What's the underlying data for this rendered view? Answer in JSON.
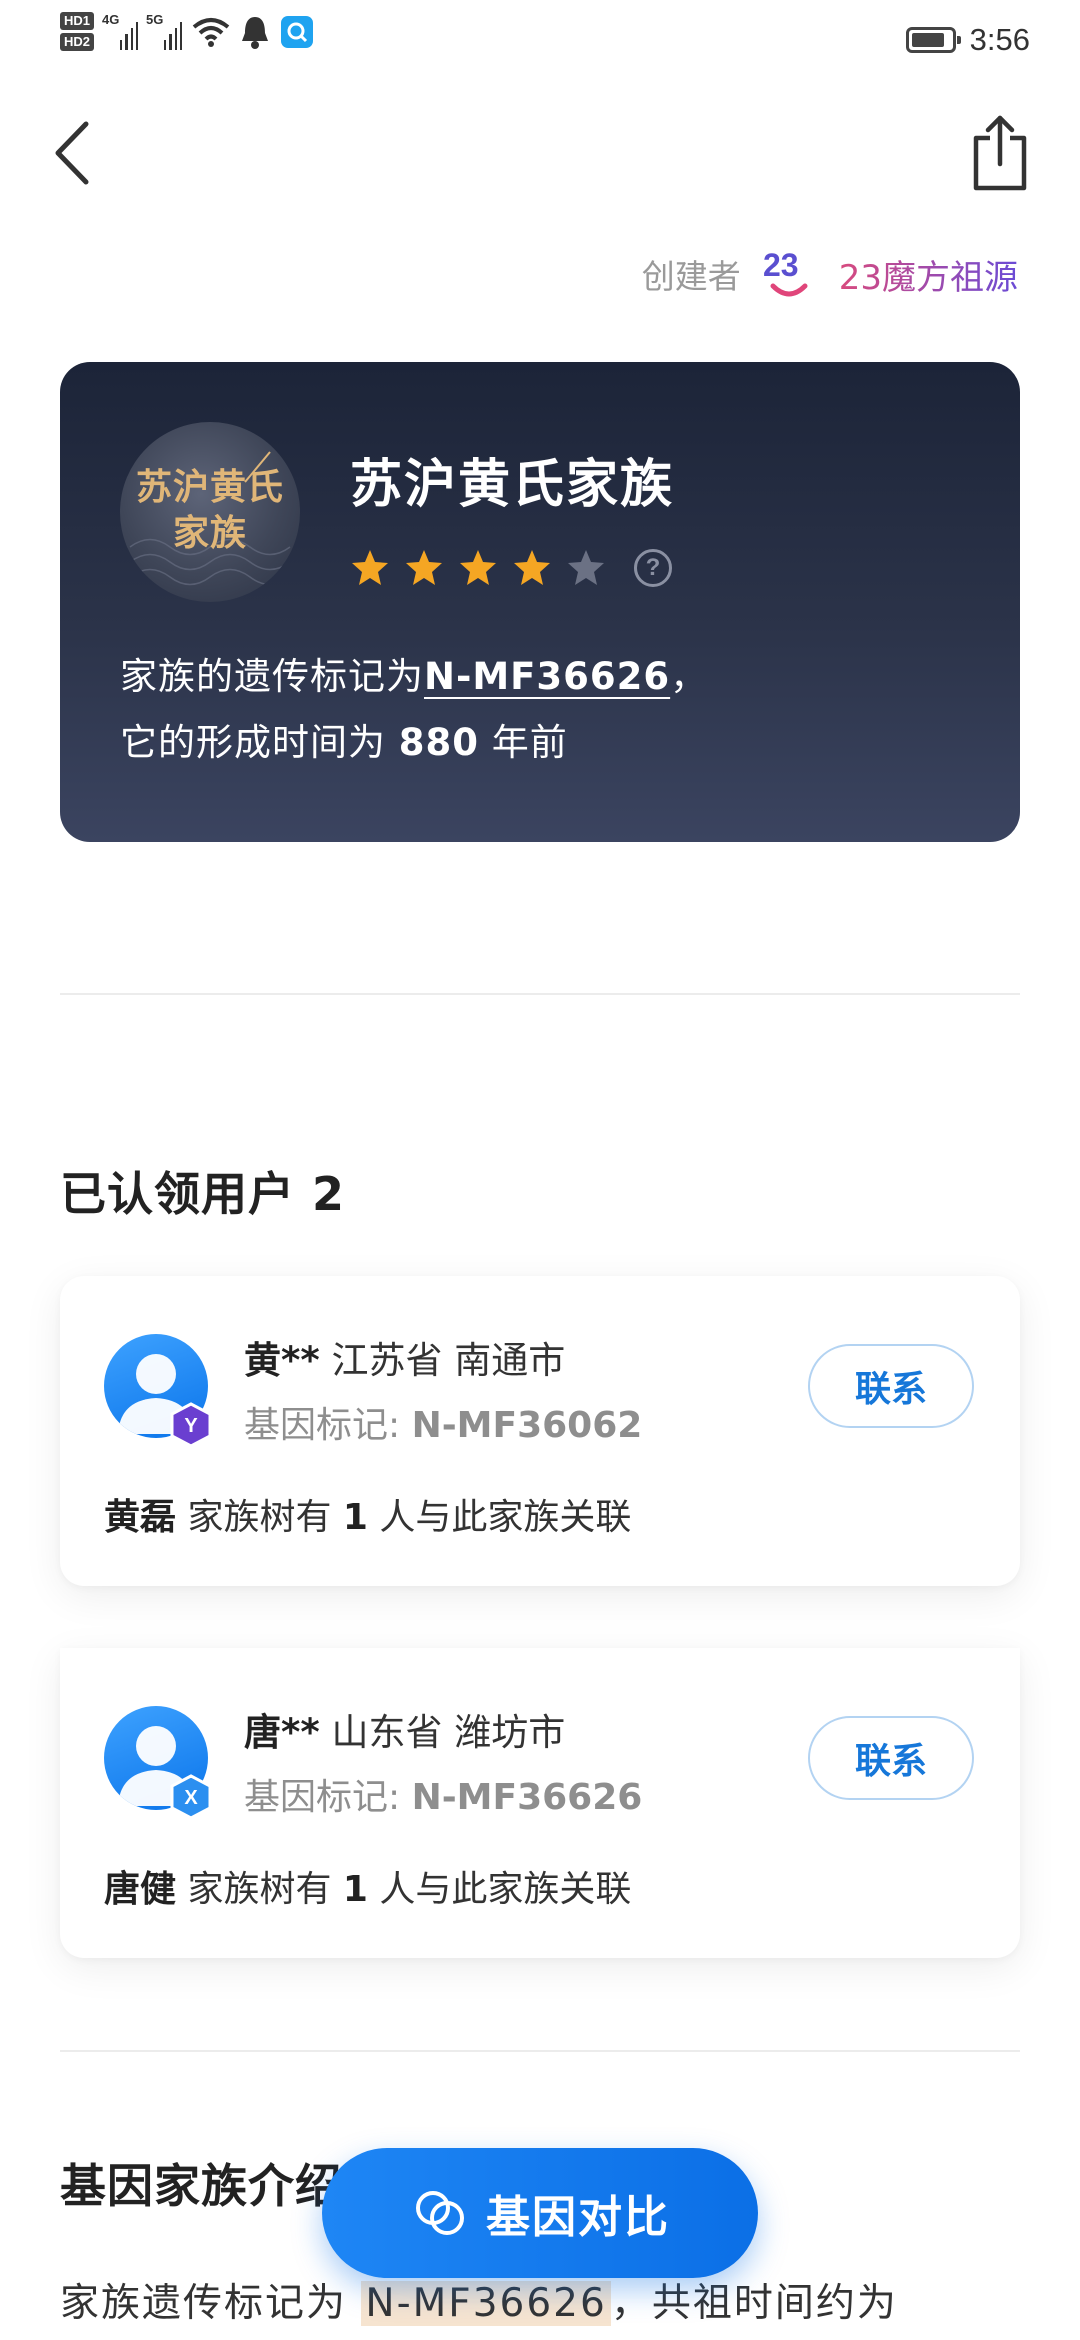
{
  "status_bar": {
    "hd1": "HD1",
    "hd2": "HD2",
    "net1": "4G",
    "net2": "5G",
    "time": "3:56"
  },
  "creator": {
    "label": "创建者",
    "logo_text": "23",
    "name": "23魔方祖源"
  },
  "family_card": {
    "badge_text_line1": "苏沪黄氏",
    "badge_text_line2": "家族",
    "title": "苏沪黄氏家族",
    "rating": 4,
    "rating_max": 5,
    "help": "?",
    "marker_prefix": "家族的遗传标记为",
    "marker_code": "N-MF36626",
    "marker_suffix": "，",
    "age_prefix": "它的形成时间为 ",
    "age_years": "880",
    "age_suffix": " 年前"
  },
  "claimed": {
    "title": "已认领用户 2",
    "users": [
      {
        "surname": "黄**",
        "location": " 江苏省 南通市",
        "marker_label": "基因标记: ",
        "marker": "N-MF36062",
        "badge_letter": "Y",
        "contact": "联系",
        "tree_name": "黄磊",
        "tree_prefix": " 家族树有 ",
        "tree_count": "1",
        "tree_suffix": " 人与此家族关联"
      },
      {
        "surname": "唐**",
        "location": " 山东省 潍坊市",
        "marker_label": "基因标记: ",
        "marker": "N-MF36626",
        "badge_letter": "X",
        "contact": "联系",
        "tree_name": "唐健",
        "tree_prefix": " 家族树有 ",
        "tree_count": "1",
        "tree_suffix": " 人与此家族关联"
      }
    ]
  },
  "intro": {
    "title": "基因家族介绍",
    "text_prefix": "家族遗传标记为 ",
    "text_code": "N-MF36626",
    "text_suffix": "，共祖时间约为"
  },
  "compare_button": {
    "label": "基因对比"
  },
  "colors": {
    "card_bg": "#2b3349",
    "star_on": "#f5a623",
    "star_off": "#6b7184",
    "accent_blue": "#1677d9",
    "badge_gold": "#e0b678"
  }
}
